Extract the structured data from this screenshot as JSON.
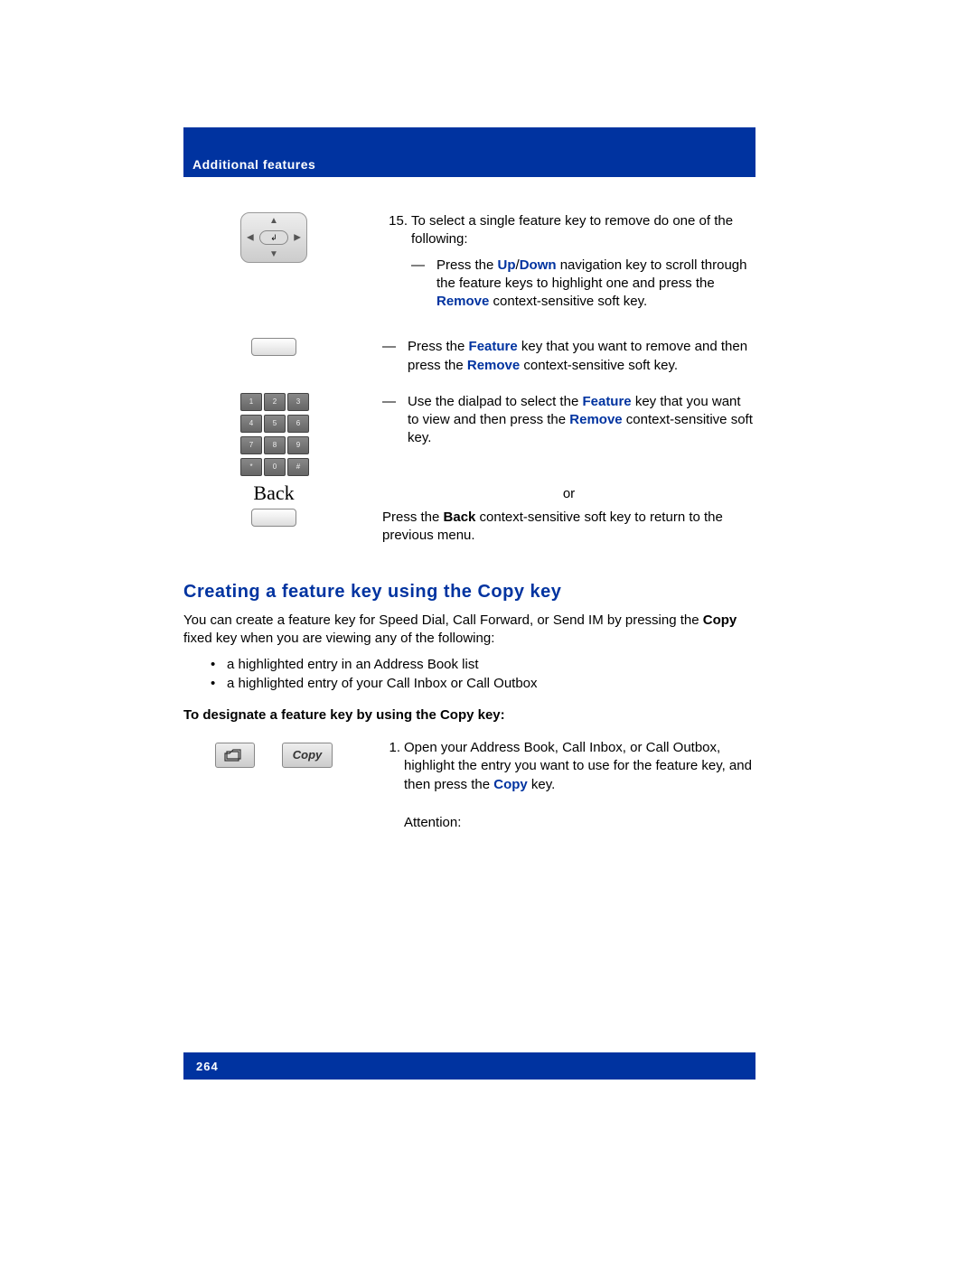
{
  "header": {
    "title": "Additional features"
  },
  "step15": {
    "number": "15.",
    "intro": "To select a single feature key to remove do one of the following:",
    "items": [
      {
        "prefix": "— Press the ",
        "k1": "Up",
        "sep": "/",
        "k2": "Down",
        "mid": " navigation key to scroll through the feature keys to highlight one and press the ",
        "k3": "Remove",
        "suffix": " context-sensitive soft key."
      },
      {
        "prefix": "— Press the ",
        "k1": "Feature",
        "mid1": " key that you want to remove and then press the ",
        "k2": "Remove",
        "suffix": " context-sensitive soft key."
      },
      {
        "prefix": "— Use the dialpad to select the ",
        "k1": "Feature",
        "mid1": " key that you want to view and then press the ",
        "k2": "Remove",
        "suffix": " context-sensitive soft key."
      }
    ],
    "or": "or",
    "back_text_prefix": "Press the ",
    "back_kw": "Back",
    "back_text_suffix": " context-sensitive soft key to return to the previous menu.",
    "back_label": "Back"
  },
  "section": {
    "heading": "Creating a feature key using the Copy key",
    "para_prefix": "You can create a feature key for Speed Dial, Call Forward, or Send IM by pressing the ",
    "para_kw": "Copy",
    "para_suffix": " fixed key when you are viewing any of the following:",
    "bullets": [
      "a highlighted entry in an Address Book list",
      "a highlighted entry of your Call Inbox or Call Outbox"
    ],
    "sub_bold": "To designate a feature key by using the Copy key:"
  },
  "copy_step": {
    "number": "1.",
    "text_prefix": "Open your Address Book, Call Inbox, or Call Outbox, highlight the entry you want to use for the feature key, and then press the ",
    "kw": "Copy",
    "text_suffix": " key.",
    "attention": "Attention:",
    "copy_label": "Copy"
  },
  "footer": {
    "page": "264"
  }
}
